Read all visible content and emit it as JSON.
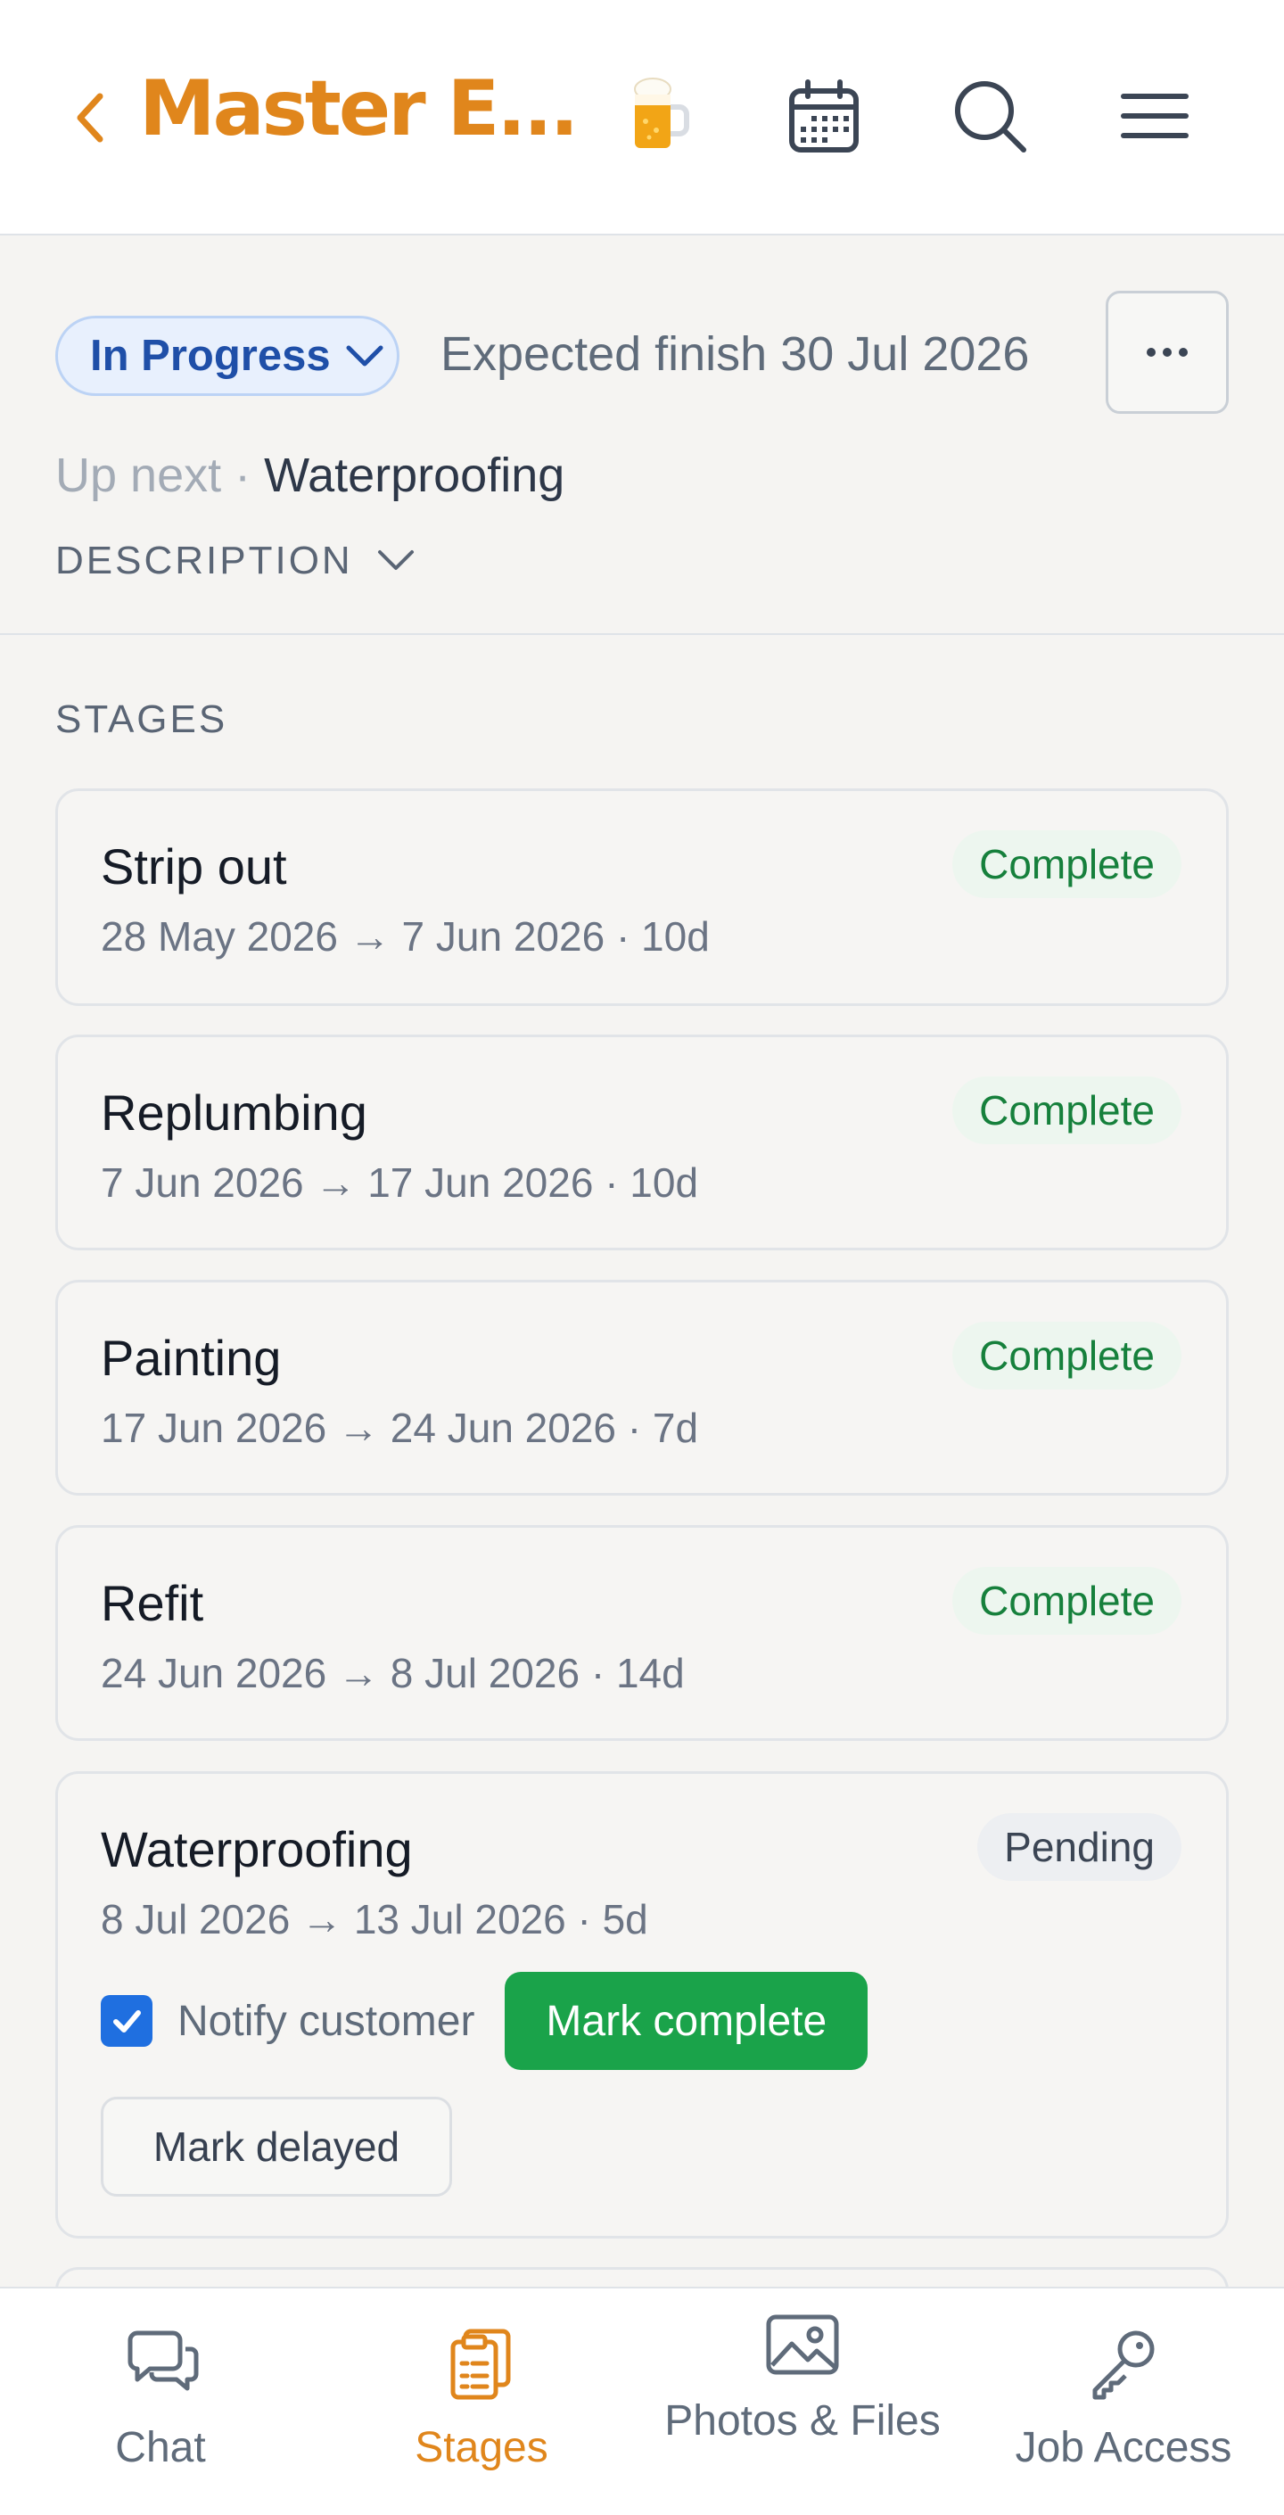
{
  "header": {
    "title": "Master E...",
    "icons": [
      "chevron-left-icon",
      "beer-icon",
      "calendar-icon",
      "search-icon",
      "menu-icon"
    ],
    "accent_color": "#e0861c"
  },
  "status": {
    "pill_label": "In Progress",
    "expected_finish": "Expected finish 30 Jul 2026",
    "more_label": "···",
    "up_next_label": "Up next ·",
    "up_next_value": "Waterproofing",
    "description_label": "DESCRIPTION"
  },
  "stages": {
    "heading": "STAGES",
    "items": [
      {
        "name": "Strip out",
        "dates": "28 May 2026 → 7 Jun 2026 · 10d",
        "status": "Complete"
      },
      {
        "name": "Replumbing",
        "dates": "7 Jun 2026 → 17 Jun 2026 · 10d",
        "status": "Complete"
      },
      {
        "name": "Painting",
        "dates": "17 Jun 2026 → 24 Jun 2026 · 7d",
        "status": "Complete"
      },
      {
        "name": "Refit",
        "dates": "24 Jun 2026 → 8 Jul 2026 · 14d",
        "status": "Complete"
      },
      {
        "name": "Waterproofing",
        "dates": "8 Jul 2026 → 13 Jul 2026 · 5d",
        "status": "Pending"
      }
    ],
    "notify_label": "Notify customer",
    "notify_checked": true,
    "mark_complete_label": "Mark complete",
    "mark_delayed_label": "Mark delayed",
    "complete_color": "#16803c",
    "action_color": "#1aa34a"
  },
  "nav": {
    "items": [
      {
        "label": "Chat",
        "icon": "chat-icon"
      },
      {
        "label": "Stages",
        "icon": "clipboard-icon",
        "active": true
      },
      {
        "label": "Photos & Files",
        "icon": "image-icon"
      },
      {
        "label": "Job Access",
        "icon": "key-icon"
      }
    ]
  }
}
